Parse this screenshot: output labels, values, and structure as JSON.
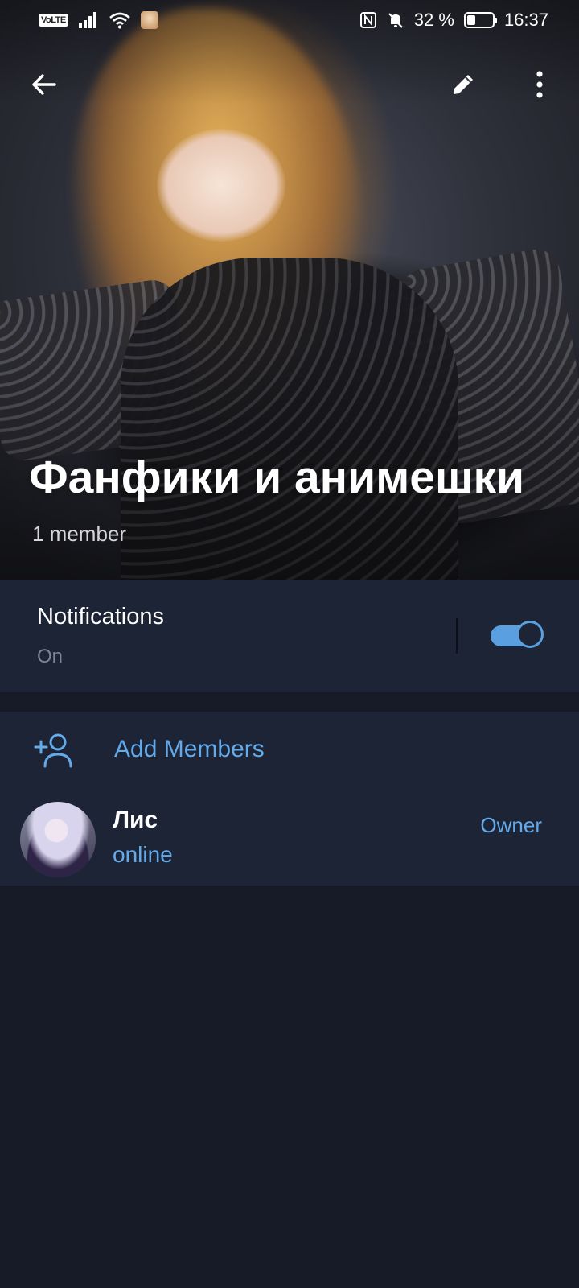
{
  "status_bar": {
    "volte": "VoLTE",
    "battery": "32 %",
    "time": "16:37"
  },
  "toolbar": {
    "back_icon": "arrow-back-icon",
    "edit_icon": "pencil-icon",
    "more_icon": "more-vertical-icon"
  },
  "group": {
    "title": "Фанфики и анимешки",
    "members_count": "1 member"
  },
  "notifications": {
    "label": "Notifications",
    "value": "On",
    "enabled": true
  },
  "members": {
    "add_label": "Add Members",
    "list": [
      {
        "name": "Лис",
        "status": "online",
        "role": "Owner"
      }
    ]
  },
  "colors": {
    "background": "#161b27",
    "card": "#1c2436",
    "accent": "#64aaea",
    "toggle": "#5aa0e0",
    "muted": "#7d8594"
  }
}
